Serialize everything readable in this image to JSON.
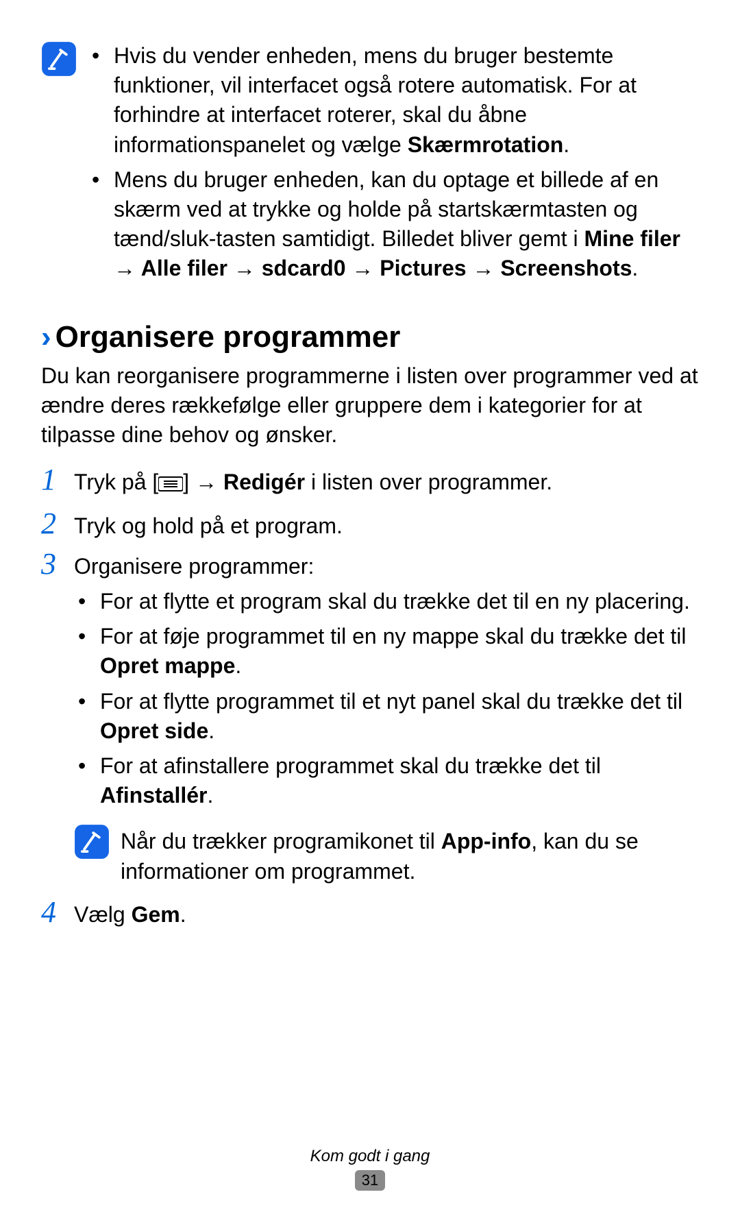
{
  "note1": {
    "bullets": [
      {
        "prefix": "Hvis du vender enheden, mens du bruger bestemte funktioner, vil interfacet også rotere automatisk. For at forhindre at interfacet roterer, skal du åbne informationspanelet og vælge ",
        "bold1": "Skærmrotation",
        "suffix": "."
      },
      {
        "prefix": "Mens du bruger enheden, kan du optage et billede af en skærm ved at trykke og holde på startskærmtasten og tænd/sluk-tasten samtidigt. Billedet bliver gemt i ",
        "bold1": "Mine filer → Alle filer → sdcard0 → Pictures → Screenshots",
        "suffix": "."
      }
    ]
  },
  "section": {
    "heading": "Organisere programmer",
    "intro": "Du kan reorganisere programmerne i listen over programmer ved at ændre deres rækkefølge eller gruppere dem i kategorier for at tilpasse dine behov og ønsker."
  },
  "steps": {
    "s1": {
      "num": "1",
      "pre": "Tryk på [",
      "post_icon": "] → ",
      "bold": "Redigér",
      "tail": " i listen over programmer."
    },
    "s2": {
      "num": "2",
      "text": "Tryk og hold på et program."
    },
    "s3": {
      "num": "3",
      "lead": "Organisere programmer:",
      "bullets": [
        {
          "pre": "For at flytte et program skal du trække det til en ny placering.",
          "bold": "",
          "post": ""
        },
        {
          "pre": "For at føje programmet til en ny mappe skal du trække det til ",
          "bold": "Opret mappe",
          "post": "."
        },
        {
          "pre": "For at flytte programmet til et nyt panel skal du trække det til ",
          "bold": "Opret side",
          "post": "."
        },
        {
          "pre": "For at afinstallere programmet skal du trække det til ",
          "bold": "Afinstallér",
          "post": "."
        }
      ]
    },
    "s4": {
      "num": "4",
      "pre": "Vælg ",
      "bold": "Gem",
      "post": "."
    }
  },
  "inner_note": {
    "pre": "Når du trækker programikonet til ",
    "bold": "App-info",
    "post": ", kan du se informationer om programmet."
  },
  "footer": {
    "chapter": "Kom godt i gang",
    "page": "31"
  }
}
